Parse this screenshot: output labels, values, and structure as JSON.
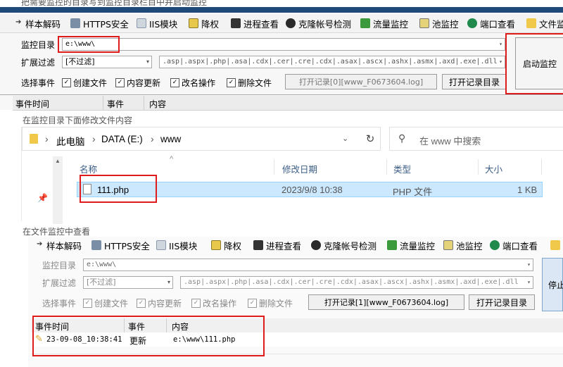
{
  "captions": {
    "top": "把需要监控的目录写到监控目录栏目中并启动监控",
    "middle": "在监控目录下面修改文件内容",
    "bottom": "在文件监控中查看"
  },
  "toolbar": {
    "items": [
      "样本解码",
      "HTTPS安全",
      "IIS模块",
      "降权",
      "进程查看",
      "克隆帐号检测",
      "流量监控",
      "池监控",
      "端口查看",
      "文件监"
    ]
  },
  "monitor1": {
    "dir_label": "监控目录",
    "dir_value": "e:\\www\\",
    "filter_label": "扩展过滤",
    "filter_value": "[不过滤]",
    "ext_value": ".asp|.aspx|.php|.asa|.cdx|.cer|.cre|.cdx|.asax|.ascx|.ashx|.asmx|.axd|.exe|.dll",
    "events_label": "选择事件",
    "chk_create": "创建文件",
    "chk_update": "内容更新",
    "chk_rename": "改名操作",
    "chk_delete": "删除文件",
    "open_log_btn": "打开记录[0][www_F0673604.log]",
    "open_dir_btn": "打开记录目录",
    "start_btn": "启动监控",
    "col_time": "事件时间",
    "col_event": "事件",
    "col_content": "内容"
  },
  "explorer": {
    "path_pc": "此电脑",
    "path_drive": "DATA (E:)",
    "path_folder": "www",
    "search_placeholder": "在 www 中搜索",
    "col_name": "名称",
    "col_date": "修改日期",
    "col_type": "类型",
    "col_size": "大小",
    "file_name": "111.php",
    "file_date": "2023/9/8 10:38",
    "file_type": "PHP 文件",
    "file_size": "1 KB"
  },
  "toolbar2": {
    "items": [
      "样本解码",
      "HTTPS安全",
      "IIS模块",
      "降权",
      "进程查看",
      "克隆帐号检测",
      "流量监控",
      "池监控",
      "端口查看"
    ]
  },
  "monitor2": {
    "dir_label": "监控目录",
    "dir_value": "e:\\www\\",
    "filter_label": "扩展过滤",
    "filter_value": "[不过滤]",
    "ext_value": ".asp|.aspx|.php|.asa|.cdx|.cer|.cre|.cdx|.asax|.ascx|.ashx|.asmx|.axd|.exe|.dll",
    "events_label": "选择事件",
    "chk_create": "创建文件",
    "chk_update": "内容更新",
    "chk_rename": "改名操作",
    "chk_delete": "删除文件",
    "open_log_btn": "打开记录[1][www_F0673604.log]",
    "open_dir_btn": "打开记录目录",
    "stop_btn": "停止",
    "col_time": "事件时间",
    "col_event": "事件",
    "col_content": "内容",
    "row_time": "23-09-08_10:38:41",
    "row_event": "更新",
    "row_content": "e:\\www\\111.php"
  }
}
